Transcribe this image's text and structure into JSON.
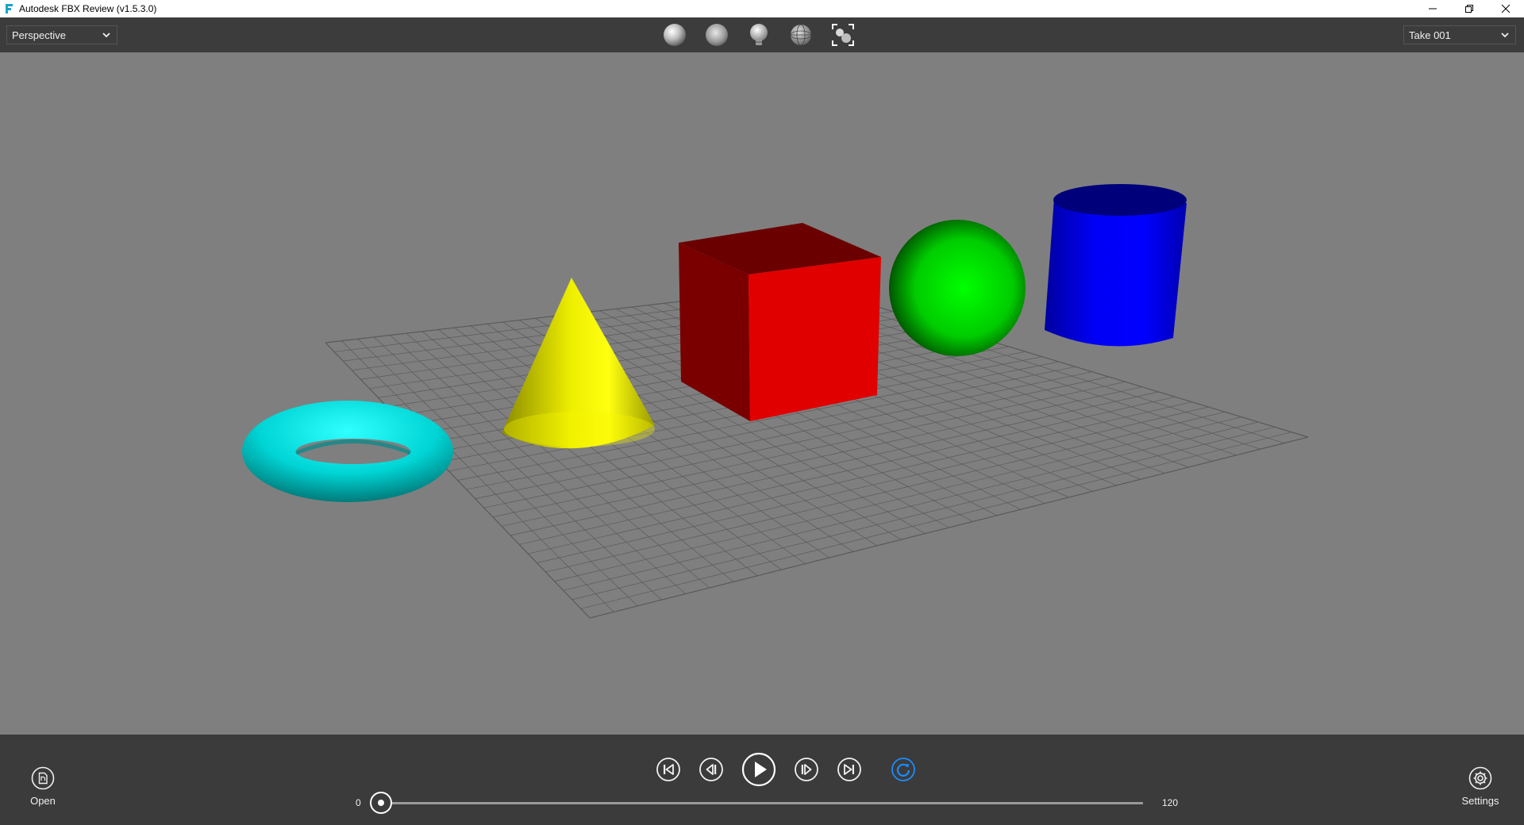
{
  "window": {
    "title": "Autodesk FBX Review (v1.5.3.0)",
    "icon": "fbx-logo-icon",
    "controls": [
      "minimize-icon",
      "restore-icon",
      "close-icon"
    ]
  },
  "toolbar": {
    "view_select": {
      "value": "Perspective"
    },
    "shading_buttons": [
      "shaded-sphere-icon",
      "smooth-sphere-icon",
      "light-bulb-icon",
      "wireframe-sphere-icon",
      "frame-all-icon"
    ],
    "take_select": {
      "value": "Take 001"
    }
  },
  "viewport": {
    "background_color": "#7f7f7f",
    "grid_color": "#5a5a5a",
    "objects": [
      {
        "name": "torus",
        "color": "#00e5e5"
      },
      {
        "name": "cone",
        "color": "#ffff00"
      },
      {
        "name": "cube",
        "color": "#ff0000"
      },
      {
        "name": "sphere",
        "color": "#00dd00"
      },
      {
        "name": "cylinder",
        "color": "#0000ff"
      }
    ]
  },
  "bottom_bar": {
    "open_label": "Open",
    "settings_label": "Settings",
    "transport": [
      "go-to-start-icon",
      "step-back-icon",
      "play-icon",
      "step-forward-icon",
      "go-to-end-icon",
      "loop-icon"
    ],
    "loop_color": "#1a8cff",
    "timeline": {
      "start": "0",
      "end": "120",
      "position": 0
    }
  }
}
